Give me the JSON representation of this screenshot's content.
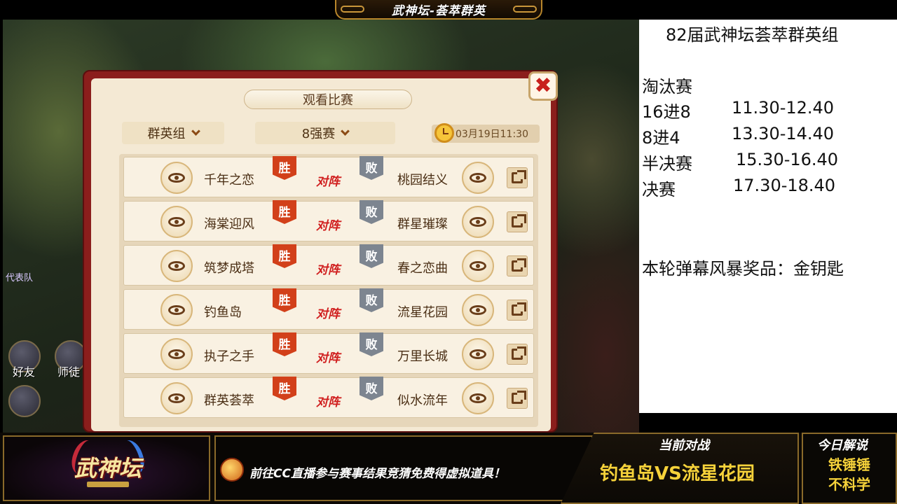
{
  "banner": {
    "title": "武神坛-荟萃群英"
  },
  "game": {
    "side_text": "代表队",
    "friends_label": "好友",
    "mentor_label": "师徒"
  },
  "dialog": {
    "title": "观看比赛",
    "group_select": "群英组",
    "round_select": "8强赛",
    "datetime": "03月19日11:30",
    "win_label": "胜",
    "lose_label": "败",
    "vs_label": "对阵",
    "matches": [
      {
        "left": "千年之恋",
        "right": "桃园结义"
      },
      {
        "left": "海棠迎风",
        "right": "群星璀璨"
      },
      {
        "left": "筑梦成塔",
        "right": "春之恋曲"
      },
      {
        "left": "钓鱼岛",
        "right": "流星花园"
      },
      {
        "left": "执子之手",
        "right": "万里长城"
      },
      {
        "left": "群英荟萃",
        "right": "似水流年"
      }
    ]
  },
  "info": {
    "title": "82届武神坛荟萃群英组",
    "stage": "淘汰赛",
    "schedule": [
      {
        "round": "16进8",
        "time": "11.30-12.40"
      },
      {
        "round": "8进4",
        "time": "13.30-14.40"
      },
      {
        "round": "半决赛",
        "time": "15.30-16.40"
      },
      {
        "round": "决赛",
        "time": "17.30-18.40"
      }
    ],
    "prize": "本轮弹幕风暴奖品：金钥匙"
  },
  "bottom": {
    "logo_text": "武神坛",
    "ticker": "前往CC直播参与赛事结果竞猜免费得虚拟道具！",
    "current_label": "当前对战",
    "current_match": "钓鱼岛VS流星花园",
    "caster_label": "今日解说",
    "caster_line1": "铁锤锤",
    "caster_line2": "不科学"
  },
  "colors": {
    "dialog_frame": "#8b1e1c",
    "win_badge": "#d2401a",
    "lose_badge": "#7d8590",
    "vs_text": "#d01e1e",
    "highlight_gold": "#f6d23a"
  }
}
